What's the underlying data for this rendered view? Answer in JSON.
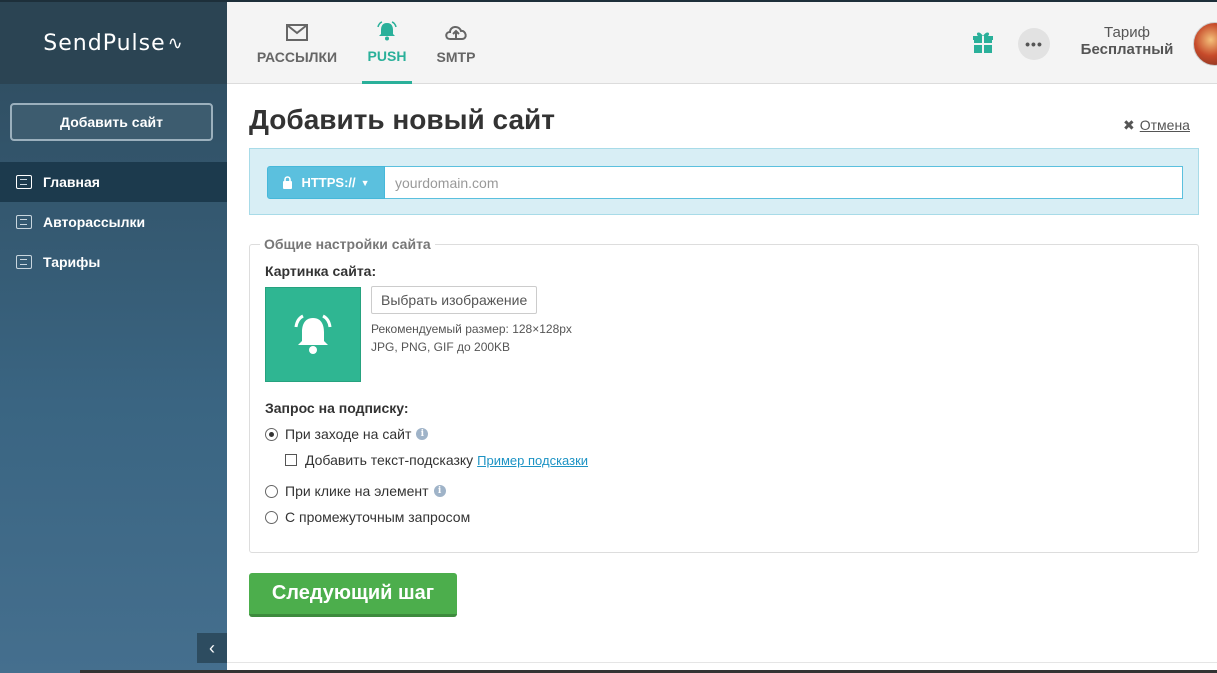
{
  "brand": {
    "name": "SendPulse",
    "pulse_glyph": "∿"
  },
  "sidebar": {
    "add_site_label": "Добавить сайт",
    "items": [
      {
        "label": "Главная",
        "icon": "dashboard-icon",
        "active": true
      },
      {
        "label": "Авторассылки",
        "icon": "automation-icon",
        "active": false
      },
      {
        "label": "Тарифы",
        "icon": "wallet-icon",
        "active": false
      }
    ],
    "collapse_glyph": "‹"
  },
  "header": {
    "tabs": [
      {
        "label": "РАССЫЛКИ",
        "icon": "envelope-icon",
        "active": false
      },
      {
        "label": "PUSH",
        "icon": "bell-icon",
        "active": true
      },
      {
        "label": "SMTP",
        "icon": "cloud-upload-icon",
        "active": false
      }
    ],
    "more_glyph": "•••",
    "plan_label": "Тариф",
    "plan_name": "Бесплатный"
  },
  "main": {
    "title": "Добавить новый сайт",
    "cancel_glyph": "✖",
    "cancel_label": "Отмена",
    "protocol_label": "HTTPS://",
    "domain_placeholder": "yourdomain.com",
    "domain_value": "",
    "settings_legend": "Общие настройки сайта",
    "picture_label": "Картинка сайта:",
    "choose_image_label": "Выбрать изображение",
    "recommended_size": "Рекомендуемый размер: 128×128px",
    "formats": "JPG, PNG, GIF до 200KB",
    "subscription_label": "Запрос на подписку:",
    "options": {
      "on_visit": "При заходе на сайт",
      "add_hint": "Добавить текст-подсказку",
      "hint_example": "Пример подсказки",
      "on_click": "При клике на элемент",
      "intermediate": "С промежуточным запросом"
    },
    "info_glyph": "i",
    "next_step_label": "Следующий шаг"
  },
  "colors": {
    "accent_green": "#2ab09a",
    "push_preview_bg": "#2fb692",
    "info_blue": "#5bc0de",
    "button_green": "#4cae4c",
    "sidebar_active": "#1c3a4d"
  }
}
